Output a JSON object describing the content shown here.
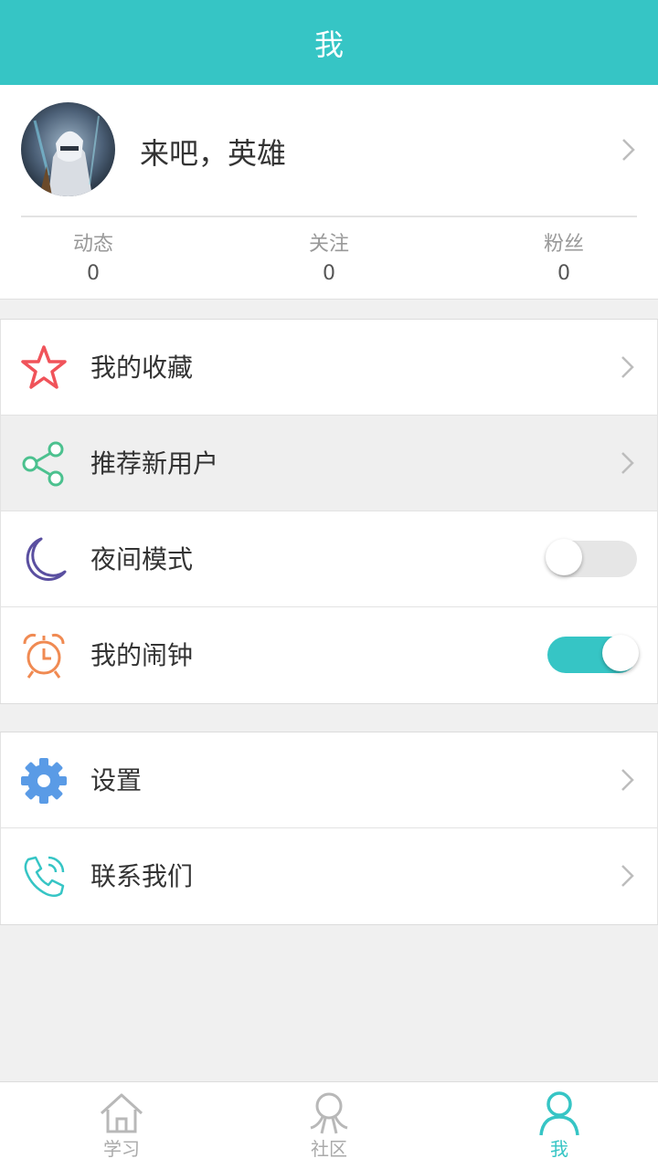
{
  "header": {
    "title": "我"
  },
  "profile": {
    "name": "来吧，英雄",
    "stats": [
      {
        "label": "动态",
        "value": "0"
      },
      {
        "label": "关注",
        "value": "0"
      },
      {
        "label": "粉丝",
        "value": "0"
      }
    ]
  },
  "menu": {
    "favorites": {
      "label": "我的收藏",
      "icon": "star-icon"
    },
    "recommend": {
      "label": "推荐新用户",
      "icon": "share-icon"
    },
    "night_mode": {
      "label": "夜间模式",
      "icon": "moon-icon",
      "enabled": false
    },
    "alarm": {
      "label": "我的闹钟",
      "icon": "alarm-clock-icon",
      "enabled": true
    },
    "settings": {
      "label": "设置",
      "icon": "gear-icon"
    },
    "contact": {
      "label": "联系我们",
      "icon": "phone-icon"
    }
  },
  "bottom_nav": {
    "items": [
      {
        "label": "学习",
        "icon": "home-icon",
        "active": false
      },
      {
        "label": "社区",
        "icon": "community-icon",
        "active": false
      },
      {
        "label": "我",
        "icon": "person-icon",
        "active": true
      }
    ]
  },
  "colors": {
    "accent": "#36c5c5",
    "star": "#f0535a",
    "share": "#4cc18f",
    "moon": "#5a4fa0",
    "alarm": "#f08a52",
    "gear": "#5a9be6",
    "phone": "#36c5c5"
  }
}
